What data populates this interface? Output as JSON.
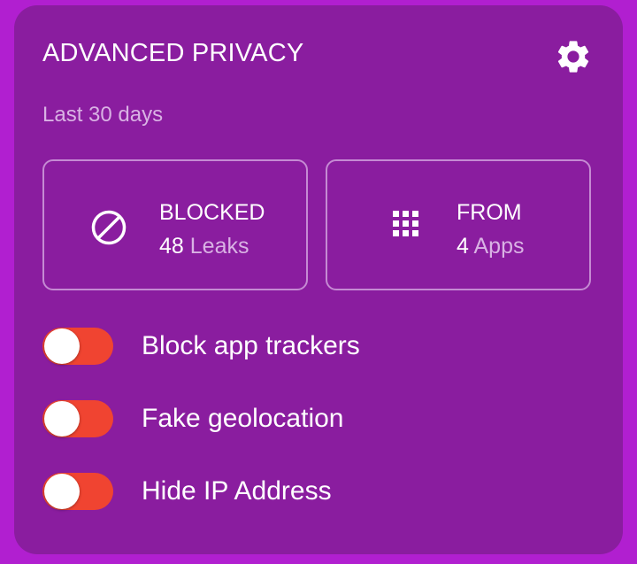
{
  "widget": {
    "title": "ADVANCED PRIVACY",
    "period": "Last 30 days",
    "settings_icon": "gear-icon"
  },
  "stats": {
    "blocked": {
      "icon": "block-icon",
      "label": "BLOCKED",
      "count": "48",
      "unit": "Leaks"
    },
    "from": {
      "icon": "apps-grid-icon",
      "label": "FROM",
      "count": "4",
      "unit": "Apps"
    }
  },
  "toggles": [
    {
      "label": "Block app trackers",
      "enabled": false
    },
    {
      "label": "Fake geolocation",
      "enabled": false
    },
    {
      "label": "Hide IP Address",
      "enabled": false
    }
  ],
  "colors": {
    "background": "#b11fd0",
    "card": "#8a1d9f",
    "accent_toggle": "#f04431",
    "muted_text": "#d9b2e4",
    "box_border": "#c58ad3"
  }
}
